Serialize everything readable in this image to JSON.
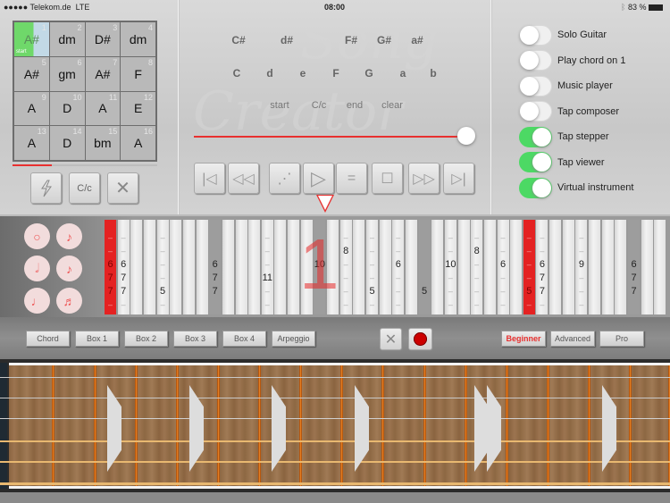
{
  "status_bar": {
    "carrier": "●●●●● Telekom.de",
    "network": "LTE",
    "time": "08:00",
    "bluetooth_icon": "bluetooth-icon",
    "battery": "83 %",
    "battery_icon": "battery-icon"
  },
  "chord_grid": {
    "cells": [
      {
        "n": "1",
        "chord": "A#",
        "active": true,
        "tag": "start"
      },
      {
        "n": "2",
        "chord": "dm"
      },
      {
        "n": "3",
        "chord": "D#"
      },
      {
        "n": "4",
        "chord": "dm"
      },
      {
        "n": "5",
        "chord": "A#"
      },
      {
        "n": "6",
        "chord": "gm"
      },
      {
        "n": "7",
        "chord": "A#"
      },
      {
        "n": "8",
        "chord": "F"
      },
      {
        "n": "9",
        "chord": "A"
      },
      {
        "n": "10",
        "chord": "D"
      },
      {
        "n": "11",
        "chord": "A"
      },
      {
        "n": "12",
        "chord": "E"
      },
      {
        "n": "13",
        "chord": "A"
      },
      {
        "n": "14",
        "chord": "D"
      },
      {
        "n": "15",
        "chord": "bm"
      },
      {
        "n": "16",
        "chord": "A"
      }
    ],
    "progress": 0.27,
    "buttons": {
      "flash_icon": "lightning-icon",
      "case_label": "C/c",
      "clear_icon": "close-icon"
    }
  },
  "song_creator": {
    "watermark_line1": "Song",
    "watermark_line2": "Creator",
    "sharp_keys": [
      "C#",
      "d#",
      "F#",
      "G#",
      "a#"
    ],
    "natural_keys": [
      "C",
      "d",
      "e",
      "F",
      "G",
      "a",
      "b"
    ],
    "commands": [
      "start",
      "C/c",
      "end",
      "clear"
    ],
    "tempo_slider_value": 1.0,
    "transport": [
      "skip-back-icon",
      "rewind-icon",
      "magic-wand-icon",
      "play-icon",
      "equals-icon",
      "stop-icon",
      "fast-forward-icon",
      "skip-forward-icon"
    ],
    "transport_equals": "="
  },
  "toggles": [
    {
      "label": "Solo Guitar",
      "on": false
    },
    {
      "label": "Play chord on 1",
      "on": false
    },
    {
      "label": "Music player",
      "on": false
    },
    {
      "label": "Tap composer",
      "on": false
    },
    {
      "label": "Tap stepper",
      "on": true
    },
    {
      "label": "Tap viewer",
      "on": true
    },
    {
      "label": "Virtual instrument",
      "on": true
    }
  ],
  "note_buttons": [
    "whole-note-icon",
    "eighth-note-icon",
    "half-note-icon",
    "sixteenth-note-icon",
    "quarter-note-icon",
    "thirty-second-note-icon"
  ],
  "note_glyphs": [
    "○",
    "♪",
    "𝅗𝅥",
    "♬",
    "♩",
    "♬"
  ],
  "tab": {
    "beat_marker": "1",
    "columns": [
      {
        "i": 0,
        "type": "red",
        "rows": [
          "-",
          "-",
          "6",
          "7",
          "7",
          "-"
        ]
      },
      {
        "i": 1,
        "type": "normal",
        "rows": [
          "-",
          "-",
          "6",
          "7",
          "7",
          "-"
        ]
      },
      {
        "i": 4,
        "type": "normal",
        "rows": [
          "-",
          "-",
          "-",
          "-",
          "5",
          "-"
        ]
      },
      {
        "i": 8,
        "type": "grey",
        "rows": [
          "",
          "",
          "6",
          "7",
          "7",
          ""
        ]
      },
      {
        "i": 12,
        "type": "normal",
        "rows": [
          "-",
          "-",
          "-",
          "11",
          "-",
          "-"
        ]
      },
      {
        "i": 16,
        "type": "grey",
        "rows": [
          "",
          "",
          "10",
          "",
          "",
          ""
        ]
      },
      {
        "i": 18,
        "type": "normal",
        "rows": [
          "-",
          "8",
          "-",
          "-",
          "-",
          "-"
        ]
      },
      {
        "i": 20,
        "type": "normal",
        "rows": [
          "-",
          "-",
          "-",
          "-",
          "5",
          "-"
        ]
      },
      {
        "i": 22,
        "type": "normal",
        "rows": [
          "-",
          "-",
          "6",
          "-",
          "-",
          "-"
        ]
      },
      {
        "i": 24,
        "type": "grey",
        "rows": [
          "",
          "",
          "",
          "",
          "5",
          ""
        ]
      },
      {
        "i": 26,
        "type": "normal",
        "rows": [
          "-",
          "-",
          "10",
          "-",
          "-",
          "-"
        ]
      },
      {
        "i": 28,
        "type": "normal",
        "rows": [
          "-",
          "8",
          "-",
          "-",
          "-",
          "-"
        ]
      },
      {
        "i": 30,
        "type": "normal",
        "rows": [
          "-",
          "-",
          "6",
          "-",
          "-",
          "-"
        ]
      },
      {
        "i": 32,
        "type": "red",
        "rows": [
          "-",
          "-",
          "-",
          "-",
          "5",
          "-"
        ]
      },
      {
        "i": 33,
        "type": "normal",
        "rows": [
          "-",
          "-",
          "6",
          "7",
          "7",
          "-"
        ]
      },
      {
        "i": 36,
        "type": "normal",
        "rows": [
          "-",
          "-",
          "9",
          "-",
          "-",
          "-"
        ]
      },
      {
        "i": 40,
        "type": "grey",
        "rows": [
          "",
          "",
          "6",
          "7",
          "7",
          ""
        ]
      }
    ],
    "column_count": 43
  },
  "controls": {
    "modes": [
      "Chord",
      "Box 1",
      "Box 2",
      "Box 3",
      "Box 4",
      "Arpeggio"
    ],
    "delete_icon": "close-icon",
    "record_icon": "record-icon",
    "levels": [
      {
        "label": "Beginner",
        "active": true
      },
      {
        "label": "Advanced",
        "active": false
      },
      {
        "label": "Pro",
        "active": false
      }
    ],
    "active_color": "#e8302f"
  },
  "fretboard": {
    "frets": 15,
    "inlay_positions": [
      3,
      5,
      7,
      9,
      12,
      15
    ],
    "string_count": 6
  }
}
